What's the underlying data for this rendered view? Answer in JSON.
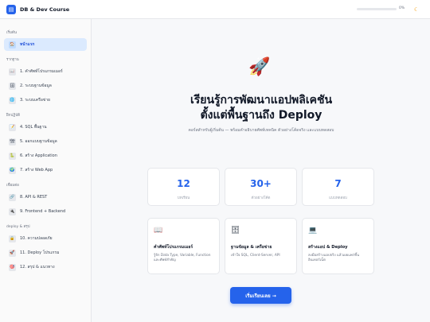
{
  "header": {
    "logo_icon": "book-icon",
    "title": "DB & Dev Course",
    "progress_percent": 0,
    "progress_label": "0%",
    "theme_icon": "moon-icon",
    "accent": "#2563eb"
  },
  "sidebar": {
    "sections": [
      {
        "label": "เริ่มต้น",
        "items": [
          {
            "icon": "home-icon",
            "glyph": "🏠",
            "label": "หน้าแรก",
            "active": true
          }
        ]
      },
      {
        "label": "รากฐาน",
        "items": [
          {
            "icon": "book-icon",
            "glyph": "📖",
            "label": "1. คำศัพท์โปรแกรมเมอร์"
          },
          {
            "icon": "database-icon",
            "glyph": "🗄",
            "label": "2. ระบบฐานข้อมูล"
          },
          {
            "icon": "globe-icon",
            "glyph": "🌐",
            "label": "3. ระบบเครือข่าย"
          }
        ]
      },
      {
        "label": "ฝึกปฏิบัติ",
        "items": [
          {
            "icon": "pencil-icon",
            "glyph": "📝",
            "label": "4. SQL พื้นฐาน"
          },
          {
            "icon": "schema-icon",
            "glyph": "🏗",
            "label": "5. ออกแบบฐานข้อมูล"
          },
          {
            "icon": "python-icon",
            "glyph": "🐍",
            "label": "6. สร้าง Application"
          },
          {
            "icon": "web-icon",
            "glyph": "🌍",
            "label": "7. สร้าง Web App"
          }
        ]
      },
      {
        "label": "เชื่อมต่อ",
        "items": [
          {
            "icon": "link-icon",
            "glyph": "🔗",
            "label": "8. API & REST"
          },
          {
            "icon": "plug-icon",
            "glyph": "🔌",
            "label": "9. Frontend + Backend"
          }
        ]
      },
      {
        "label": "deploy & สรุป",
        "items": [
          {
            "icon": "lock-icon",
            "glyph": "🔒",
            "label": "10. ความปลอดภัย"
          },
          {
            "icon": "rocket-icon",
            "glyph": "🚀",
            "label": "11. Deploy โปรแกรม"
          },
          {
            "icon": "target-icon",
            "glyph": "🎯",
            "label": "12. สรุป & แนวทาง"
          }
        ]
      }
    ]
  },
  "hero": {
    "icon": "rocket-icon",
    "title_line1": "เรียนรู้การพัฒนาแอปพลิเคชัน",
    "title_line2": "ตั้งแต่พื้นฐานถึง Deploy",
    "subtitle": "คอร์สสำหรับผู้เริ่มต้น — พร้อมคำอธิบายศัพท์เทคนิค ตัวอย่างโค้ดจริง และแบบทดสอบ"
  },
  "stats": [
    {
      "value": "12",
      "label": "บทเรียน"
    },
    {
      "value": "30+",
      "label": "ตัวอย่างโค้ด"
    },
    {
      "value": "7",
      "label": "แบบทดสอบ"
    }
  ],
  "features": [
    {
      "icon": "book-icon",
      "glyph": "📖",
      "title": "คำศัพท์โปรแกรมเมอร์",
      "desc": "รู้จัก Data Type, Variable, Function และศัพท์สำคัญ"
    },
    {
      "icon": "database-icon",
      "glyph": "🗄",
      "title": "ฐานข้อมูล & เครือข่าย",
      "desc": "เข้าใจ SQL, Client-Server, API"
    },
    {
      "icon": "laptop-icon",
      "glyph": "💻",
      "title": "สร้างแอป & Deploy",
      "desc": "ลงมือสร้างแอปจริง แล้วเผยแพร่ขึ้นอินเทอร์เน็ต"
    }
  ],
  "cta": {
    "label": "เริ่มเรียนเลย →"
  }
}
